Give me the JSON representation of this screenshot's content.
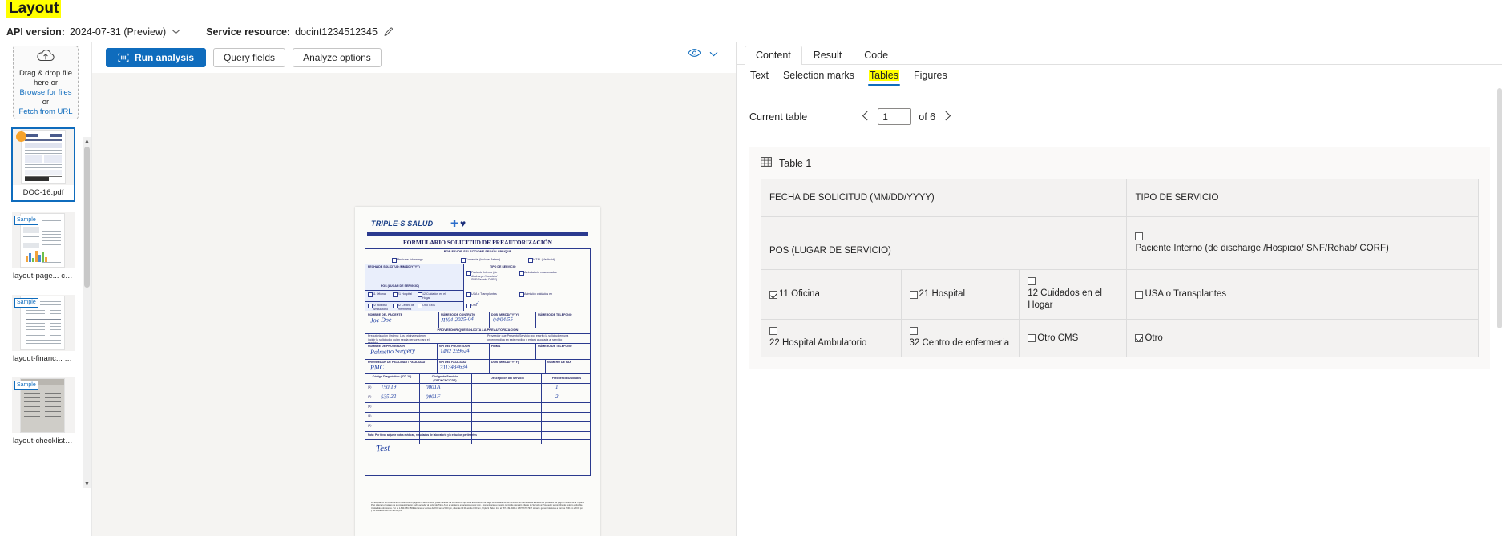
{
  "header": {
    "title": "Layout",
    "api_version_label": "API version:",
    "api_version_value": "2024-07-31 (Preview)",
    "service_resource_label": "Service resource:",
    "service_resource_value": "docint1234512345",
    "edit_icon": "pencil-icon",
    "dropdown_icon": "chevron-down-icon"
  },
  "left_rail": {
    "dropzone": {
      "icon": "cloud-upload-icon",
      "line1": "Drag & drop file",
      "line2": "here or",
      "browse_link": "Browse for files",
      "or": "or",
      "fetch_link": "Fetch from URL"
    },
    "files": [
      {
        "name": "DOC-16.pdf",
        "selected": true,
        "badge": "",
        "dot": true
      },
      {
        "name": "layout-page... ct.pdf",
        "selected": false,
        "badge": "Sample",
        "dot": false
      },
      {
        "name": "layout-financ... rt.jpg",
        "selected": false,
        "badge": "Sample",
        "dot": false
      },
      {
        "name": "layout-checklist.jpg",
        "selected": false,
        "badge": "Sample",
        "dot": false
      }
    ]
  },
  "toolbar": {
    "run_analysis": "Run analysis",
    "query_fields": "Query fields",
    "analyze_options": "Analyze options",
    "run_icon": "scan-icon",
    "eye_icon": "eye-icon",
    "eye_chevron": "chevron-down-icon"
  },
  "viewer": {
    "form_logo": "TRIPLE-S SALUD",
    "form_title": "FORMULARIO SOLICITUD DE PREAUTORIZACIÓN",
    "form_subtitle": "POR FAVOR SELECCIONE SEGÚN APLIQUE",
    "opt_medicare": "Medicare Advantage",
    "opt_comercial": "Comercial (Incluye Patient)",
    "opt_vital": "VITAL (Medicaid)",
    "sec_fecha": "FECHA DE SOLICITUD (MM/DD/YYYY)",
    "sec_tipo": "TIPO DE SERVICIO",
    "sec_pos": "POS (LUGAR DE SERVICIO)",
    "sec_nombre": "NOMBRE DEL PACIENTE",
    "sec_contrato": "NÚMERO DE CONTRATO",
    "sec_dob": "DOB (MM/DD/YYYY)",
    "sec_tel": "NÚMERO DE TELÉFONO",
    "sec_proveedor": "PROVEEDOR QUE SOLICITA LA PREAUTORIZACIÓN",
    "sec_nombre_prov": "NOMBRE DE PROVEEDOR",
    "sec_npi": "NPI DEL PROVEEDOR",
    "sec_firma": "FIRMA",
    "sec_tel2": "NÚMERO DE TELÉFONO",
    "sec_fac": "PROVEEDOR DE FACILIDAD / FACILIDAD",
    "sec_npi_fac": "NPI DEL FACILIDAD",
    "sec_fax": "NÚMERO DE FAX",
    "col_codigo": "Código Diagnóstico (ICD-10)",
    "col_codigo2": "Código de Servicio (CPT/HCPC/CDT)",
    "col_desc": "Descripción del Servicio",
    "col_freq": "Frecuencia/Unidades",
    "hand_name": "Joe  Doe",
    "hand_contract": "JH04-2025-04",
    "hand_dob": "04/04/55",
    "hand_provider": "Palmetto Surgery",
    "hand_npi": "1482 259624",
    "hand_fac": "PMC",
    "hand_npifac": "3113434634",
    "hand_row1_a": "150.19",
    "hand_row1_b": "0001A",
    "hand_row1_c": "1",
    "hand_row2_a": "535.22",
    "hand_row2_b": "0001F",
    "hand_row2_c": "2",
    "hand_note": "Test",
    "notes_line": "Nota: Por favor adjunte notas médicas, resultados de laboratorio y/o estudios pertinentes"
  },
  "right": {
    "primary_tabs": [
      {
        "label": "Content",
        "active": true
      },
      {
        "label": "Result",
        "active": false
      },
      {
        "label": "Code",
        "active": false
      }
    ],
    "secondary_tabs": [
      {
        "label": "Text",
        "active": false
      },
      {
        "label": "Selection marks",
        "active": false
      },
      {
        "label": "Tables",
        "active": true
      },
      {
        "label": "Figures",
        "active": false
      }
    ],
    "pager": {
      "label": "Current table",
      "prev_icon": "chevron-left-icon",
      "next_icon": "chevron-right-icon",
      "current": "1",
      "of": "of 6"
    },
    "table_card": {
      "icon": "table-icon",
      "title": "Table 1",
      "rows": [
        [
          {
            "text": "FECHA DE SOLICITUD (MM/DD/YYYY)",
            "colspan": 3,
            "mark": "none",
            "layout": "inline"
          },
          {
            "text": "TIPO DE SERVICIO",
            "colspan": 2,
            "mark": "none",
            "layout": "inline"
          }
        ],
        [
          {
            "text": "",
            "colspan": 3,
            "mark": "none",
            "layout": "inline"
          },
          {
            "text": "Paciente Interno (de discharge /Hospicio/ SNF/Rehab/ CORF)",
            "colspan": 2,
            "mark": "unchecked",
            "layout": "stack"
          }
        ],
        [
          {
            "text": "POS (LUGAR DE SERVICIO)",
            "colspan": 3,
            "mark": "none",
            "layout": "inline"
          }
        ],
        [
          {
            "text": "11 Oficina",
            "colspan": 1,
            "mark": "checked",
            "layout": "inline"
          },
          {
            "text": "21 Hospital",
            "colspan": 1,
            "mark": "unchecked",
            "layout": "inline"
          },
          {
            "text": "12 Cuidados en el Hogar",
            "colspan": 1,
            "mark": "unchecked",
            "layout": "stack"
          },
          {
            "text": "USA o Transplantes",
            "colspan": 2,
            "mark": "unchecked",
            "layout": "inline"
          }
        ],
        [
          {
            "text": "22 Hospital Ambulatorio",
            "colspan": 1,
            "mark": "unchecked",
            "layout": "stack"
          },
          {
            "text": "32 Centro de enfermeria",
            "colspan": 1,
            "mark": "unchecked",
            "layout": "stack"
          },
          {
            "text": "Otro CMS",
            "colspan": 1,
            "mark": "unchecked",
            "layout": "inline"
          },
          {
            "text": "Otro",
            "colspan": 2,
            "mark": "checked",
            "layout": "inline"
          }
        ]
      ]
    }
  },
  "colors": {
    "accent": "#0f6cbd",
    "highlight": "#ffff00",
    "panel_bg": "#faf9f8",
    "table_bg": "#f3f2f1",
    "viewer_bg": "#f5f4f2"
  }
}
